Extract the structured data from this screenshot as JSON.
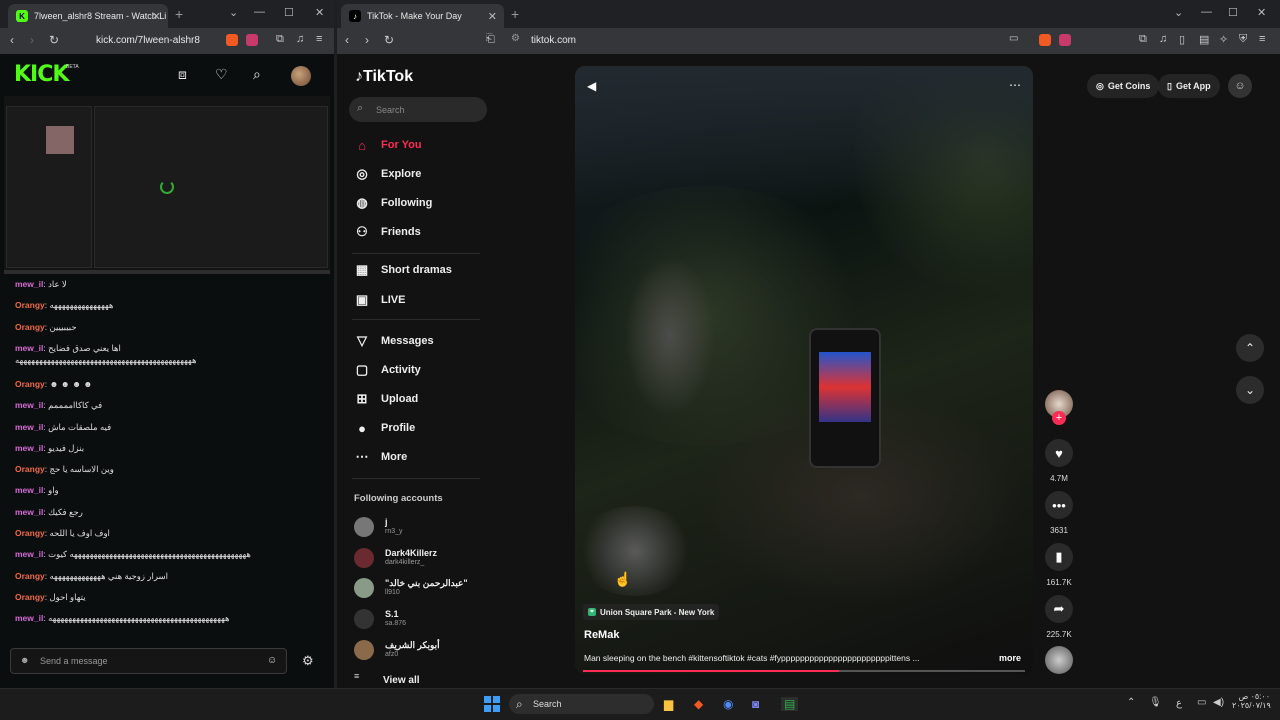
{
  "left_browser": {
    "tab_title": "7lween_alshr8 Stream - Watch Li",
    "url": "kick.com/7lween-alshr8"
  },
  "right_browser": {
    "tab_title": "TikTok - Make Your Day",
    "url": "tiktok.com"
  },
  "kick": {
    "logo": "KICK",
    "beta": "BETA",
    "chat": [
      {
        "user": "mew_il",
        "text": "لا عاد",
        "color": "#d66bd6"
      },
      {
        "user": "Orangy",
        "text": "هههههههههههههههه",
        "color": "#f26a43"
      },
      {
        "user": "Orangy",
        "text": "حبيبييين",
        "color": "#f26a43"
      },
      {
        "user": "mew_il",
        "text": "اها يعني صدق فضايح",
        "color": "#d66bd6",
        "extra": "هههههههههههههههههههههههههههههههههههههههههههههه"
      },
      {
        "user": "Orangy",
        "text": "☻ ☻ ☻ ☻",
        "color": "#f26a43"
      },
      {
        "user": "mew_il",
        "text": "في كاكااممممم",
        "color": "#d66bd6"
      },
      {
        "user": "mew_il",
        "text": "فيه ملصقات ماش",
        "color": "#d66bd6"
      },
      {
        "user": "mew_il",
        "text": "بنزل فيديو",
        "color": "#d66bd6"
      },
      {
        "user": "Orangy",
        "text": "وين الاساسه يا حج",
        "color": "#f26a43"
      },
      {
        "user": "mew_il",
        "text": "واو",
        "color": "#d66bd6"
      },
      {
        "user": "mew_il",
        "text": "رجع فكيك",
        "color": "#d66bd6"
      },
      {
        "user": "Orangy",
        "text": "اوف اوف يا اللحه",
        "color": "#f26a43"
      },
      {
        "user": "mew_il",
        "text": "هههههههههههههههههههههههههههههههههههههههههههههه كيوت",
        "color": "#d66bd6"
      },
      {
        "user": "Orangy",
        "text": "اسرار زوجية هني هههههههههههههه",
        "color": "#f26a43"
      },
      {
        "user": "Orangy",
        "text": "يتهاو احول",
        "color": "#f26a43"
      },
      {
        "user": "mew_il",
        "text": "هههههههههههههههههههههههههههههههههههههههههههههه",
        "color": "#d66bd6"
      }
    ],
    "chat_placeholder": "Send a message"
  },
  "tiktok": {
    "logo": "TikTok",
    "search_placeholder": "Search",
    "nav": [
      {
        "label": "For You",
        "icon": "home-icon",
        "active": true
      },
      {
        "label": "Explore",
        "icon": "compass-icon"
      },
      {
        "label": "Following",
        "icon": "following-icon"
      },
      {
        "label": "Friends",
        "icon": "friends-icon"
      },
      {
        "label": "Short dramas",
        "icon": "film-icon"
      },
      {
        "label": "LIVE",
        "icon": "live-icon"
      },
      {
        "label": "Messages",
        "icon": "messages-icon"
      },
      {
        "label": "Activity",
        "icon": "activity-icon"
      },
      {
        "label": "Upload",
        "icon": "upload-icon"
      },
      {
        "label": "Profile",
        "icon": "profile-icon"
      },
      {
        "label": "More",
        "icon": "more-icon"
      }
    ],
    "following_header": "Following accounts",
    "accounts": [
      {
        "name": "j",
        "handle": "rn3_y"
      },
      {
        "name": "Dark4Killerz",
        "handle": "dark4killerz_"
      },
      {
        "name": "\"عبدالرحمن بني خالد\"",
        "handle": "ll910"
      },
      {
        "name": "S.1",
        "handle": "sa.876"
      },
      {
        "name": "أبوبكر الشريف",
        "handle": "afz0"
      }
    ],
    "view_all": "View all",
    "get_coins": "Get Coins",
    "get_app": "Get App",
    "video": {
      "location": "Union Square Park - New York",
      "author": "ReMak",
      "caption": "Man sleeping on the bench #kittensoftiktok #cats #fypppppppppppppppppppppppittens ...",
      "more": "more"
    },
    "stats": {
      "likes": "4.7M",
      "comments": "3631",
      "saves": "161.7K",
      "shares": "225.7K"
    }
  },
  "taskbar": {
    "search": "Search",
    "lang": "ع",
    "time": "٠٥:٠٠ ص",
    "date": "٢٠٢٥/٠٧/١٩"
  }
}
